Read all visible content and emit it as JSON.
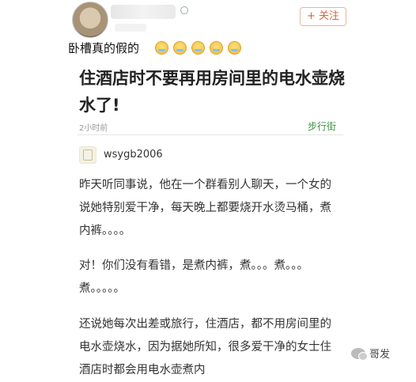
{
  "header": {
    "follow_label": "+ 关注",
    "headline": "卧槽真的假的"
  },
  "article": {
    "title": "住酒店时不要再用房间里的电水壶烧水了!",
    "time": "2小时前",
    "location": "步行街"
  },
  "comment": {
    "username": "wsygb2006",
    "paragraphs": [
      "昨天听同事说，他在一个群看别人聊天，一个女的说她特别爱干净，每天晚上都要烧开水烫马桶，煮内裤。。。。",
      "对！你们没有看错，是煮内裤，煮。。。煮。。。煮。。。。。",
      "还说她每次出差或旅行，住酒店，都不用房间里的电水壶烧水，因为据她所知，很多爱干净的女士住酒店时都会用电水壶煮内"
    ]
  },
  "watermark": {
    "text": "哥发"
  },
  "icons": {
    "avatar": "user-avatar-cat",
    "badge": "verified-badge-icon",
    "emoji": "crying-face-emoji",
    "comment_avatar": "default-avatar-icon",
    "watermark": "wechat-icon"
  },
  "colors": {
    "follow": "#d9623a",
    "location": "#3d8f3d",
    "meta": "#999999"
  }
}
